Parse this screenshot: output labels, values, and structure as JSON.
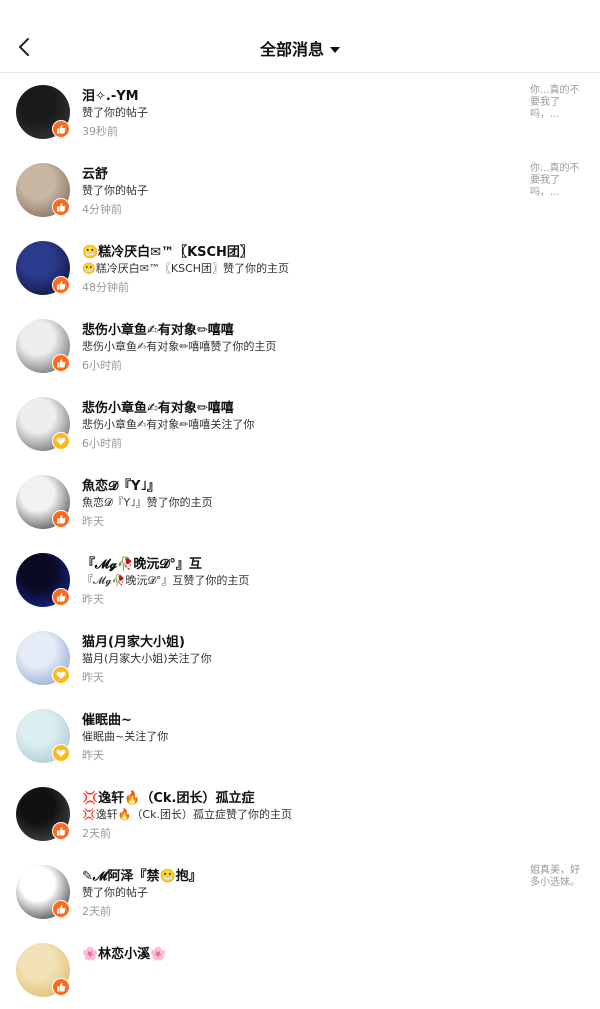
{
  "header": {
    "title": "全部消息"
  },
  "notifications": [
    {
      "name": "泪✧.-YM",
      "action": "赞了你的帖子",
      "time": "39秒前",
      "type": "like",
      "preview": "你...真的不要我了吗，...",
      "avatar_colors": [
        "#1a1a1a",
        "#3b3b3b"
      ]
    },
    {
      "name": "云舒",
      "action": "赞了你的帖子",
      "time": "4分钟前",
      "type": "like",
      "preview": "你...真的不要我了吗，...",
      "avatar_colors": [
        "#c9b7a3",
        "#6f5a4a"
      ]
    },
    {
      "name": "😬糕冷厌白✉™〖KSCH团〗",
      "action": "😬糕冷厌白✉™〖KSCH团〗赞了你的主页",
      "time": "48分钟前",
      "type": "like",
      "preview": "",
      "avatar_colors": [
        "#2a3a8c",
        "#0b0b2a"
      ]
    },
    {
      "name": "悲伤小章鱼✍有对象✏嘻嘻",
      "action": "悲伤小章鱼✍有对象✏嘻嘻赞了你的主页",
      "time": "6小时前",
      "type": "like",
      "preview": "",
      "avatar_colors": [
        "#eeeeee",
        "#4a4a4a"
      ]
    },
    {
      "name": "悲伤小章鱼✍有对象✏嘻嘻",
      "action": "悲伤小章鱼✍有对象✏嘻嘻关注了你",
      "time": "6小时前",
      "type": "follow",
      "preview": "",
      "avatar_colors": [
        "#eeeeee",
        "#4a4a4a"
      ]
    },
    {
      "name": "魚恋𝓓『Y˩』",
      "action": "魚恋𝓓『Y˩』赞了你的主页",
      "time": "昨天",
      "type": "like",
      "preview": "",
      "avatar_colors": [
        "#f2f2f2",
        "#222222"
      ]
    },
    {
      "name": "『𝓜𝓰🥀晚沅𝓓°』互",
      "action": "『𝓜𝓰🥀晚沅𝓓°』互赞了你的主页",
      "time": "昨天",
      "type": "like",
      "preview": "",
      "avatar_colors": [
        "#0a0a24",
        "#1c2aa8"
      ]
    },
    {
      "name": "猫月(月家大小姐)",
      "action": "猫月(月家大小姐)关注了你",
      "time": "昨天",
      "type": "follow",
      "preview": "",
      "avatar_colors": [
        "#e6ecf7",
        "#7d95c9"
      ]
    },
    {
      "name": "催眠曲~",
      "action": "催眠曲~关注了你",
      "time": "昨天",
      "type": "follow",
      "preview": "",
      "avatar_colors": [
        "#dbeef2",
        "#9fbfc8"
      ]
    },
    {
      "name": "💢逸轩🔥（Ck.团长）孤立症",
      "action": "💢逸轩🔥（Ck.团长）孤立症赞了你的主页",
      "time": "2天前",
      "type": "like",
      "preview": "",
      "avatar_colors": [
        "#111111",
        "#555555"
      ]
    },
    {
      "name": "✎𝓜阿泽『禁😬抱』",
      "action": "赞了你的帖子",
      "time": "2天前",
      "type": "like",
      "preview": "姐真美，好多小选妹。",
      "avatar_colors": [
        "#ffffff",
        "#111111"
      ]
    },
    {
      "name": "🌸林恋小溪🌸",
      "action": "",
      "time": "",
      "type": "like",
      "preview": "",
      "avatar_colors": [
        "#f3e2b8",
        "#d9b35a"
      ]
    }
  ]
}
